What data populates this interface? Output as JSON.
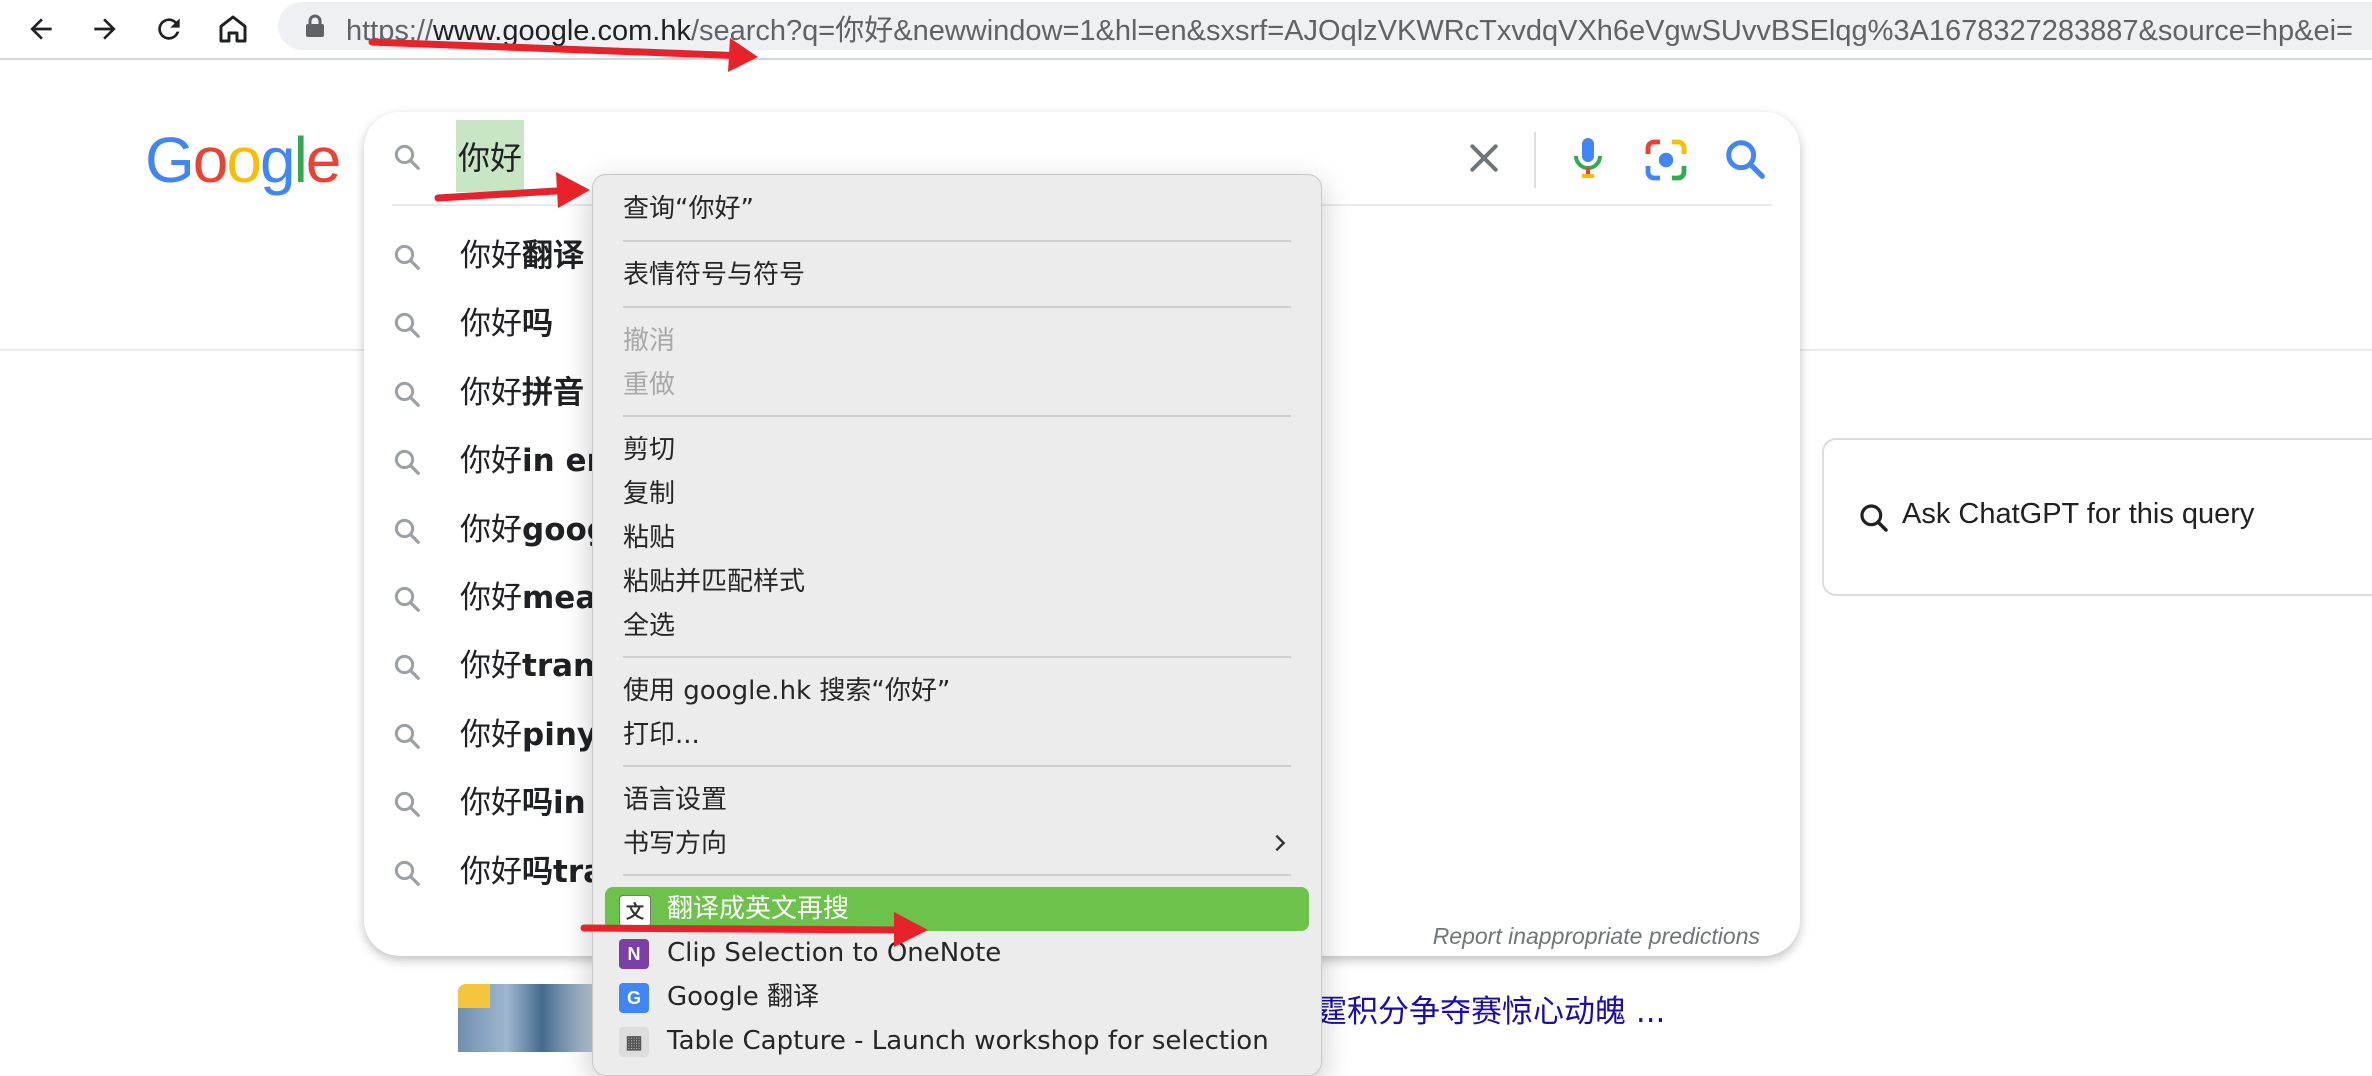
{
  "browser": {
    "url_scheme": "https://",
    "url_host": "www.google.com.hk",
    "url_rest": "/search?q=你好&newwindow=1&hl=en&sxsrf=AJOqlzVKWRcTxvdqVXh6eVgwSUvvBSElqg%3A1678327283887&source=hp&ei=",
    "nav_icons": [
      "back-arrow-icon",
      "forward-arrow-icon",
      "reload-icon",
      "home-icon"
    ]
  },
  "google": {
    "logo_letters": [
      {
        "ch": "G",
        "color": "#4285F4"
      },
      {
        "ch": "o",
        "color": "#EA4335"
      },
      {
        "ch": "o",
        "color": "#FBBC05"
      },
      {
        "ch": "g",
        "color": "#4285F4"
      },
      {
        "ch": "l",
        "color": "#34A853"
      },
      {
        "ch": "e",
        "color": "#EA4335"
      }
    ]
  },
  "search": {
    "query": "你好",
    "suggestions": [
      {
        "prefix": "你好",
        "bold": "翻译"
      },
      {
        "prefix": "你好",
        "bold": "吗"
      },
      {
        "prefix": "你好",
        "bold": "拼音"
      },
      {
        "prefix": "你好",
        "bold": "in en"
      },
      {
        "prefix": "你好",
        "bold": "goog"
      },
      {
        "prefix": "你好",
        "bold": "mean"
      },
      {
        "prefix": "你好",
        "bold": "trans"
      },
      {
        "prefix": "你好",
        "bold": "pinyi"
      },
      {
        "prefix": "你好",
        "bold": "吗in"
      },
      {
        "prefix": "你好",
        "bold": "吗tra"
      }
    ],
    "report_text": "Report inappropriate predictions"
  },
  "side_panel": {
    "label": "Ask ChatGPT for this query"
  },
  "results_peek": {
    "link_text": "霆积分争夺赛惊心动魄 ..."
  },
  "context_menu": {
    "items": [
      {
        "label": "查询“你好”",
        "state": "normal"
      },
      {
        "label": "表情符号与符号",
        "state": "normal"
      },
      {
        "label": "撤消",
        "state": "disabled"
      },
      {
        "label": "重做",
        "state": "disabled"
      },
      {
        "label": "剪切",
        "state": "normal"
      },
      {
        "label": "复制",
        "state": "normal"
      },
      {
        "label": "粘贴",
        "state": "normal"
      },
      {
        "label": "粘贴并匹配样式",
        "state": "normal"
      },
      {
        "label": "全选",
        "state": "normal"
      },
      {
        "label": "使用 google.hk 搜索“你好”",
        "state": "normal"
      },
      {
        "label": "打印...",
        "state": "normal"
      },
      {
        "label": "语言设置",
        "state": "normal"
      },
      {
        "label": "书写方向",
        "state": "submenu"
      },
      {
        "label": "翻译成英文再搜",
        "state": "highlighted",
        "icon": "translate-icon"
      },
      {
        "label": "Clip Selection to OneNote",
        "state": "normal",
        "icon": "onenote-icon"
      },
      {
        "label": "Google 翻译",
        "state": "normal",
        "icon": "google-translate-icon"
      },
      {
        "label": "Table Capture - Launch workshop for selection",
        "state": "normal",
        "icon": "table-capture-icon"
      }
    ],
    "highlight_color": "#6cc24a"
  },
  "annotation_color": "#e8222b"
}
